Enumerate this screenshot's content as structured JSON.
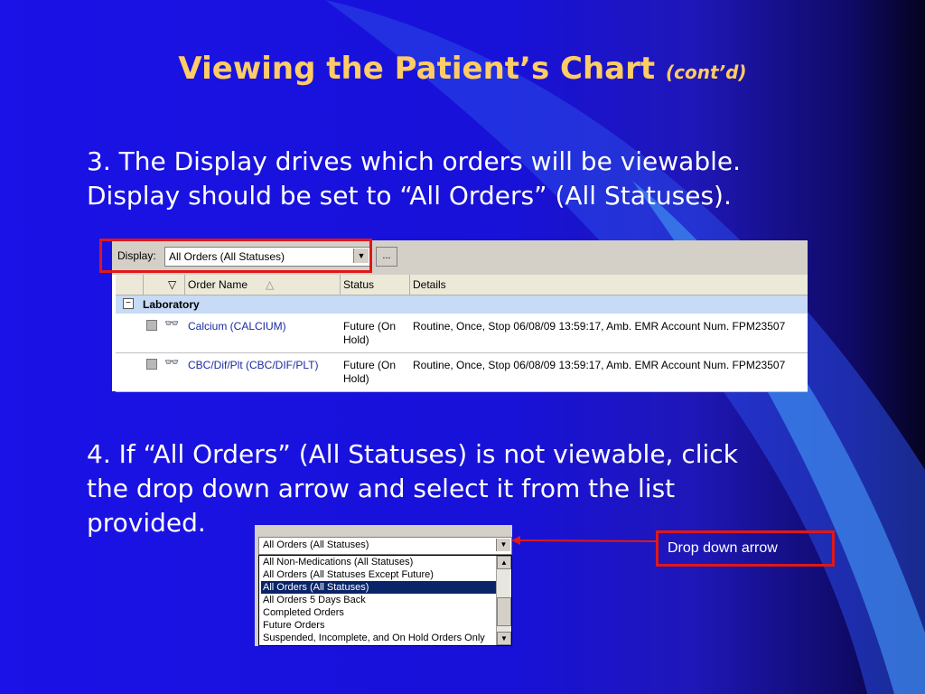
{
  "slide": {
    "title": "Viewing the Patient’s Chart",
    "title_suffix": "(cont’d)",
    "step3_line1": "3.  The Display drives which orders will be viewable.",
    "step3_line2": "Display should be set to “All Orders” (All Statuses).",
    "step4_line1": "4.  If “All Orders” (All Statuses) is not viewable, click",
    "step4_line2": "the drop down arrow and select it from the list",
    "step4_line3": "provided.",
    "callout": "Drop down arrow"
  },
  "colors": {
    "title": "#ffcc66",
    "background": "#1a12e6",
    "highlight_box": "#e01818",
    "selected_item": "#0a246a"
  },
  "orders_view": {
    "display_label": "Display:",
    "display_value": "All Orders (All Statuses)",
    "more_button": "...",
    "columns": [
      "Order Name",
      "Status",
      "Details"
    ],
    "group": "Laboratory",
    "rows": [
      {
        "order_name": "Calcium (CALCIUM)",
        "status_line1": "Future (On",
        "status_line2": "Hold)",
        "details": "Routine, Once, Stop 06/08/09 13:59:17, Amb.  EMR Account Num. FPM23507"
      },
      {
        "order_name": "CBC/Dif/Plt (CBC/DIF/PLT)",
        "status_line1": "Future (On",
        "status_line2": "Hold)",
        "details": "Routine, Once, Stop 06/08/09 13:59:17, Amb.  EMR Account Num. FPM23507"
      }
    ]
  },
  "dropdown": {
    "value": "All Orders (All Statuses)",
    "options": [
      "All Non-Medications (All Statuses)",
      "All Orders (All Statuses Except Future)",
      "All Orders (All Statuses)",
      "All Orders 5 Days Back",
      "Completed Orders",
      "Future Orders",
      "Suspended, Incomplete, and On Hold Orders Only"
    ],
    "selected_index": 2
  }
}
